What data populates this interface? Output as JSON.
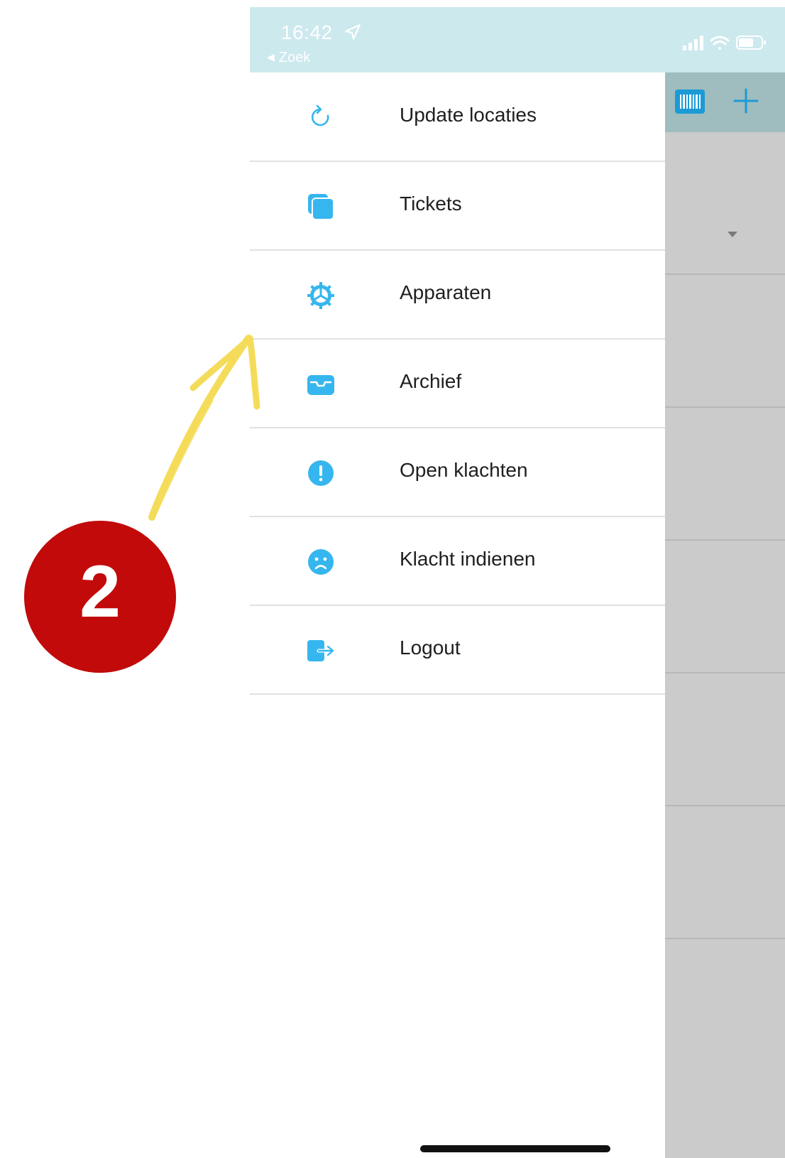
{
  "status_bar": {
    "time": "16:42",
    "back_app_label": "Zoek"
  },
  "menu": {
    "items": [
      {
        "label": "Update locaties",
        "icon": "refresh-icon"
      },
      {
        "label": "Tickets",
        "icon": "tickets-icon"
      },
      {
        "label": "Apparaten",
        "icon": "gear-icon"
      },
      {
        "label": "Archief",
        "icon": "inbox-icon"
      },
      {
        "label": "Open klachten",
        "icon": "exclamation-icon"
      },
      {
        "label": "Klacht indienen",
        "icon": "sad-face-icon"
      },
      {
        "label": "Logout",
        "icon": "logout-icon"
      }
    ]
  },
  "annotation": {
    "step_number": "2",
    "badge_color": "#c20a0a",
    "arrow_color": "#f4dc5a"
  },
  "colors": {
    "accent": "#36b6ee",
    "status_bar_bg": "#cce9ee",
    "bg_app_header": "#9fbcbf",
    "bg_app_body": "#cbcbcb"
  }
}
